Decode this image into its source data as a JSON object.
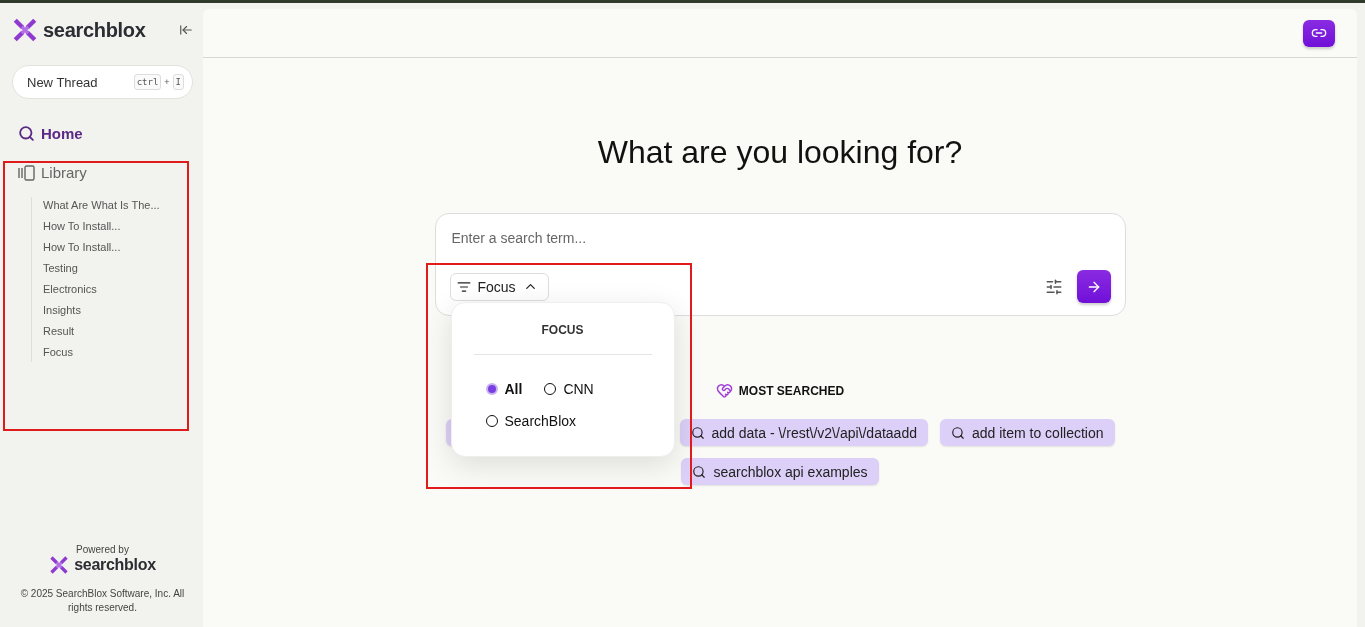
{
  "sidebar": {
    "brand": "searchblox",
    "new_thread": {
      "label": "New Thread",
      "keys": [
        "ctrl",
        "+",
        "I"
      ]
    },
    "nav": [
      {
        "label": "Home",
        "selected": true,
        "kind": "search"
      },
      {
        "label": "Library",
        "selected": false,
        "kind": "library"
      }
    ],
    "library_items": [
      "What Are What Is The...",
      "How To Install...",
      "How To Install...",
      "Testing",
      "Electronics",
      "Insights",
      "Result",
      "Focus"
    ],
    "powered_by": "Powered by",
    "footer_brand": "searchblox",
    "copyright": "© 2025 SearchBlox Software, Inc. All rights reserved."
  },
  "main": {
    "heading": "What are you looking for?",
    "search": {
      "placeholder": "Enter a search term..."
    },
    "focus_button": {
      "label": "Focus",
      "expanded": true
    },
    "focus_menu": {
      "title": "FOCUS",
      "options": [
        {
          "label": "All",
          "selected": true
        },
        {
          "label": "CNN",
          "selected": false
        },
        {
          "label": "SearchBlox",
          "selected": false
        }
      ]
    },
    "most_searched": {
      "title": "MOST SEARCHED",
      "chips": [
        {
          "kind": "covered"
        },
        {
          "query": "add data - \\/rest\\/v2\\/api\\/dataadd"
        },
        {
          "query": "add item to collection"
        },
        {
          "query": "searchblox api examples"
        }
      ]
    }
  }
}
